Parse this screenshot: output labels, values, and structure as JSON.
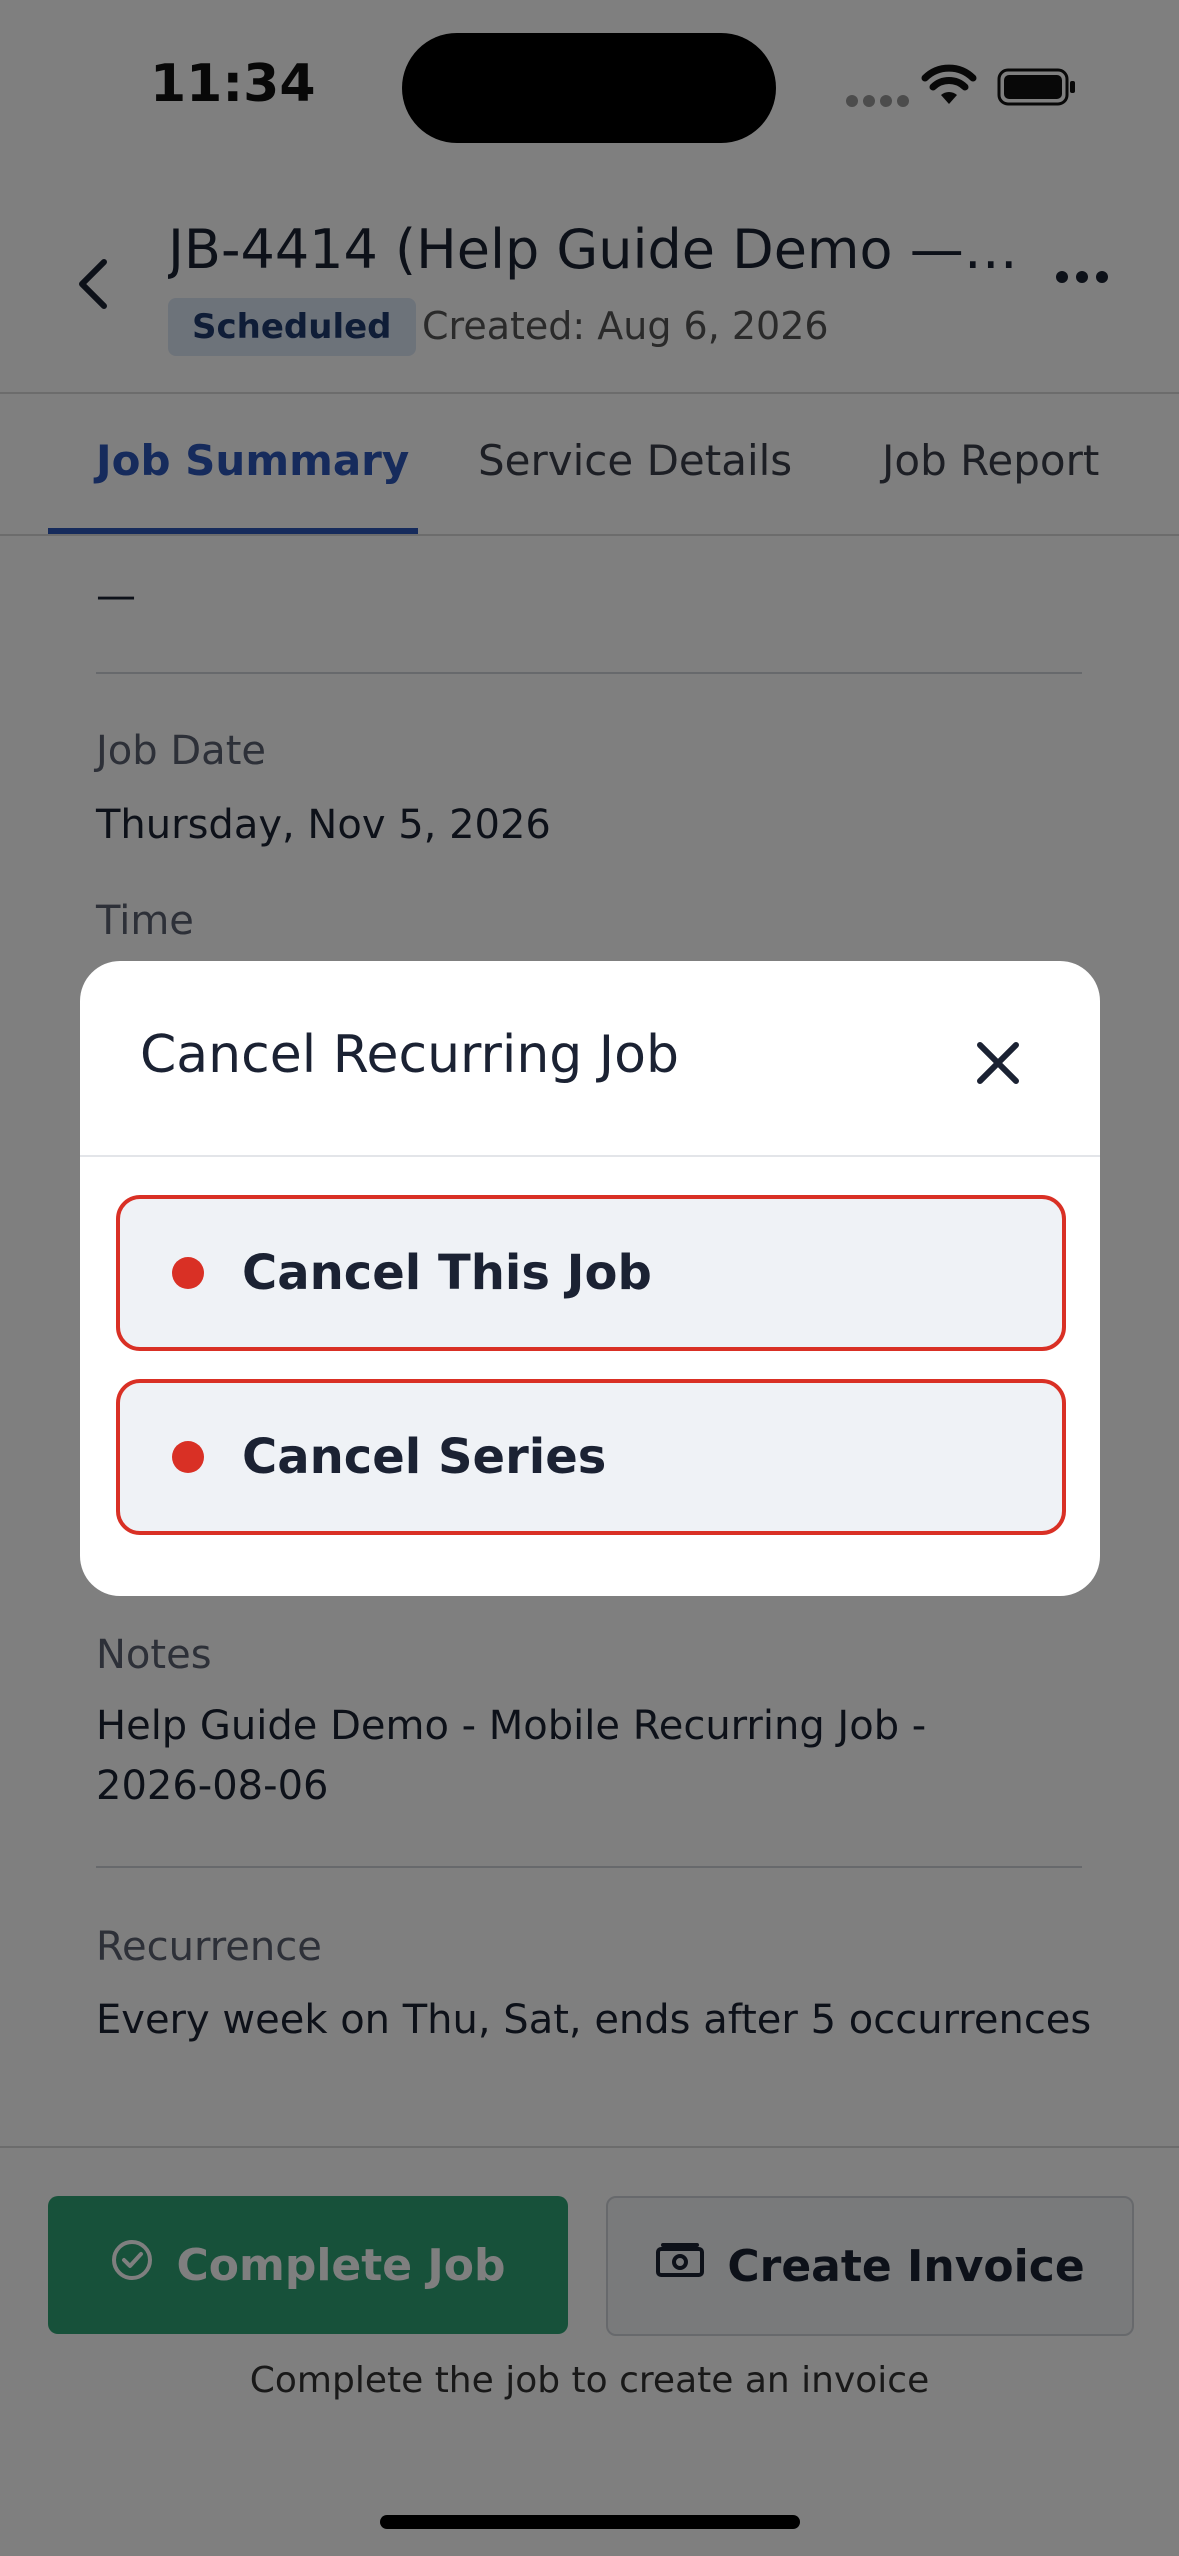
{
  "status_bar": {
    "time": "11:34"
  },
  "header": {
    "title": "JB-4414 (Help Guide Demo — Co...",
    "status_badge": "Scheduled",
    "created": "Created: Aug 6, 2026"
  },
  "tabs": [
    {
      "label": "Job Summary",
      "active": true
    },
    {
      "label": "Service Details",
      "active": false
    },
    {
      "label": "Job Report",
      "active": false
    }
  ],
  "content": {
    "top_value": "—",
    "job_date_label": "Job Date",
    "job_date_value": "Thursday, Nov 5, 2026",
    "time_label": "Time",
    "notes_label": "Notes",
    "notes_value": "Help Guide Demo - Mobile Recurring Job - 2026-08-06",
    "recurrence_label": "Recurrence",
    "recurrence_value": "Every week on Thu, Sat, ends after 5 occurrences"
  },
  "footer": {
    "complete_label": "Complete Job",
    "invoice_label": "Create Invoice",
    "hint": "Complete the job to create an invoice"
  },
  "modal": {
    "title": "Cancel Recurring Job",
    "options": [
      {
        "label": "Cancel This Job"
      },
      {
        "label": "Cancel Series"
      }
    ]
  },
  "colors": {
    "accent": "#2c56b8",
    "complete_green": "#2fa375",
    "danger_red": "#d93025",
    "overlay": "rgba(0,0,0,0.5)"
  },
  "icons": [
    "back-chevron-icon",
    "more-icon",
    "check-circle-icon",
    "cash-icon",
    "close-icon",
    "wifi-icon",
    "battery-icon"
  ]
}
